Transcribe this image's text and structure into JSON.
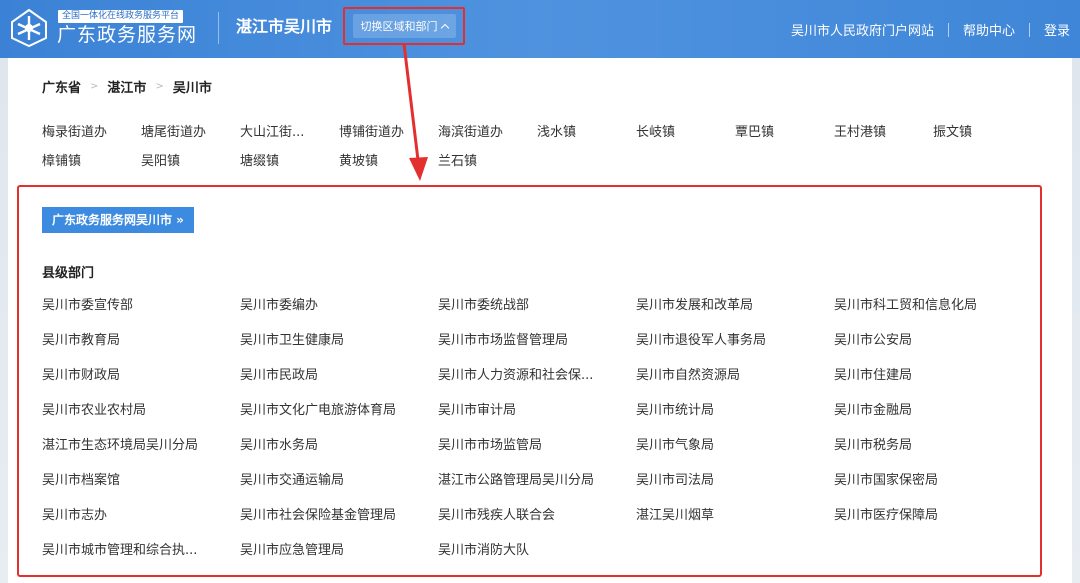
{
  "header": {
    "brand_tag": "全国一体化在线政务服务平台",
    "brand_name": "广东政务服务网",
    "city": "湛江市吴川市",
    "switch_label": "切换区域和部门",
    "links": [
      "吴川市人民政府门户网站",
      "帮助中心",
      "登录"
    ]
  },
  "breadcrumb": [
    "广东省",
    "湛江市",
    "吴川市"
  ],
  "towns": [
    "梅录街道办",
    "塘尾街道办",
    "大山江街...",
    "博铺街道办",
    "海滨街道办",
    "浅水镇",
    "长岐镇",
    "覃巴镇",
    "王村港镇",
    "振文镇",
    "樟铺镇",
    "吴阳镇",
    "塘缀镇",
    "黄坡镇",
    "兰石镇"
  ],
  "portal_button": "广东政务服务网吴川市 »",
  "section_title": "县级部门",
  "departments": [
    "吴川市委宣传部",
    "吴川市委编办",
    "吴川市委统战部",
    "吴川市发展和改革局",
    "吴川市科工贸和信息化局",
    "吴川市教育局",
    "吴川市卫生健康局",
    "吴川市市场监督管理局",
    "吴川市退役军人事务局",
    "吴川市公安局",
    "吴川市财政局",
    "吴川市民政局",
    "吴川市人力资源和社会保...",
    "吴川市自然资源局",
    "吴川市住建局",
    "吴川市农业农村局",
    "吴川市文化广电旅游体育局",
    "吴川市审计局",
    "吴川市统计局",
    "吴川市金融局",
    "湛江市生态环境局吴川分局",
    "吴川市水务局",
    "吴川市市场监管局",
    "吴川市气象局",
    "吴川市税务局",
    "吴川市档案馆",
    "吴川市交通运输局",
    "湛江市公路管理局吴川分局",
    "吴川市司法局",
    "吴川市国家保密局",
    "吴川市志办",
    "吴川市社会保险基金管理局",
    "吴川市残疾人联合会",
    "湛江吴川烟草",
    "吴川市医疗保障局",
    "吴川市城市管理和综合执...",
    "吴川市应急管理局",
    "吴川市消防大队"
  ],
  "colors": {
    "header_blue": "#3f86d8",
    "highlight_red": "#e42f2f",
    "button_blue": "#3d8be0"
  }
}
